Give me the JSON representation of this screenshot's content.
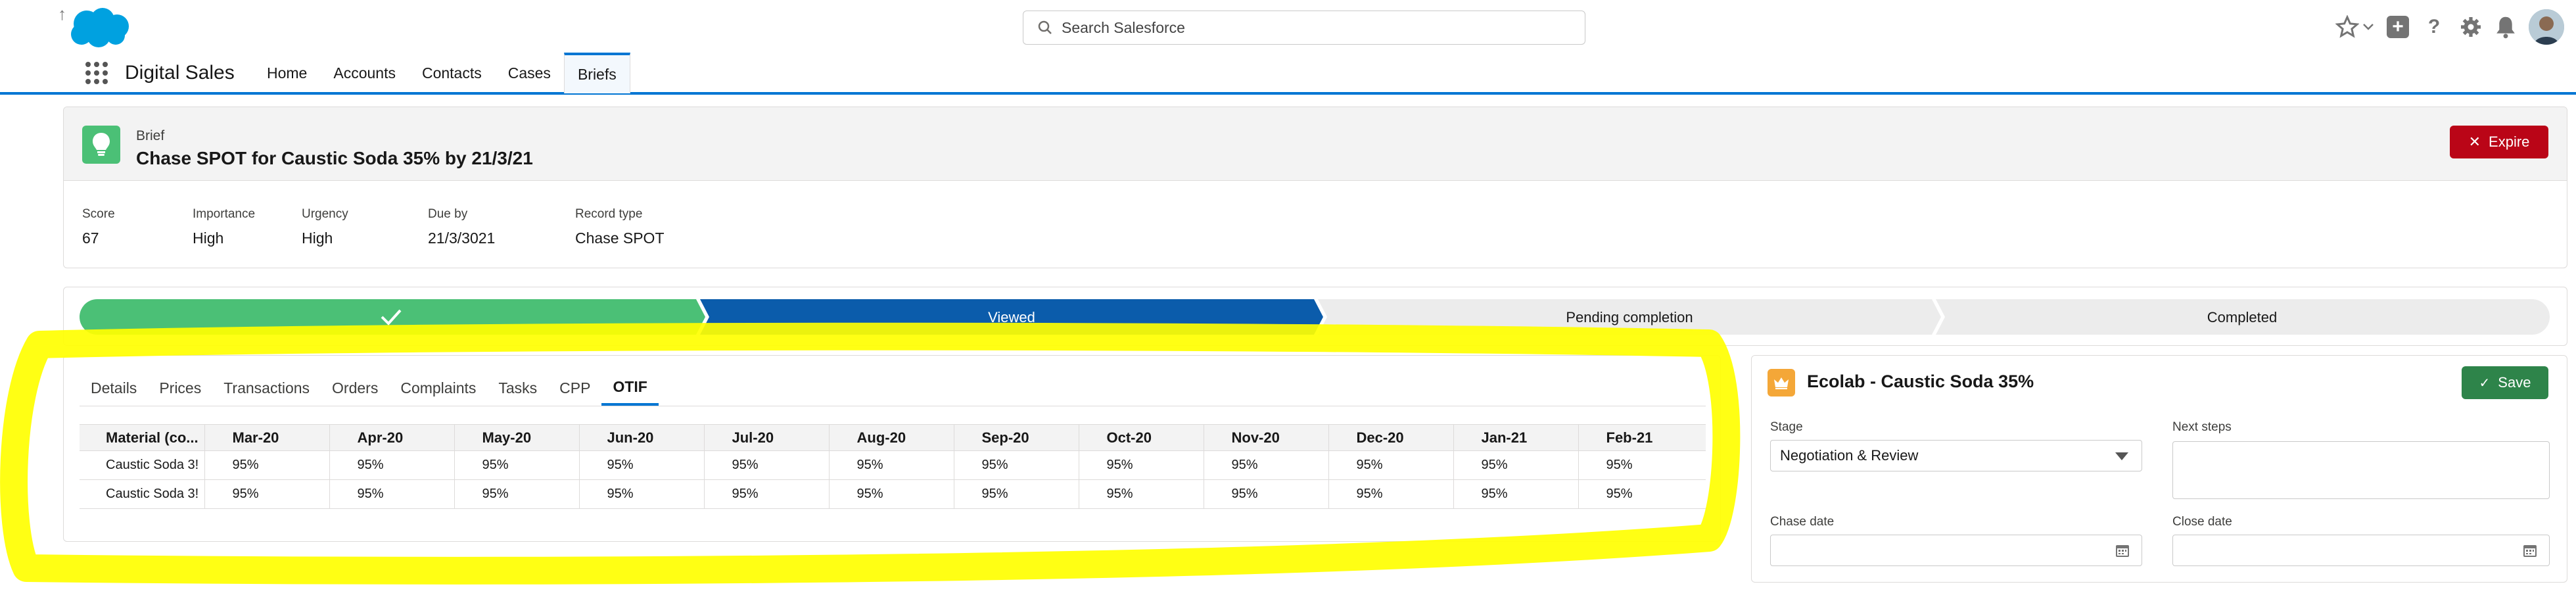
{
  "header": {
    "search_placeholder": "Search Salesforce",
    "icons": [
      "star-icon",
      "chevron-down-icon",
      "add-icon",
      "help-icon",
      "setup-gear-icon",
      "notification-bell-icon",
      "avatar"
    ]
  },
  "nav": {
    "app_name": "Digital Sales",
    "items": [
      {
        "label": "Home"
      },
      {
        "label": "Accounts"
      },
      {
        "label": "Contacts"
      },
      {
        "label": "Cases"
      },
      {
        "label": "Briefs",
        "active": true
      }
    ]
  },
  "record": {
    "object_label": "Brief",
    "title": "Chase SPOT for Caustic Soda 35% by 21/3/21",
    "expire_label": "Expire",
    "fields": [
      {
        "label": "Score",
        "value": "67"
      },
      {
        "label": "Importance",
        "value": "High"
      },
      {
        "label": "Urgency",
        "value": "High"
      },
      {
        "label": "Due by",
        "value": "21/3/3021"
      },
      {
        "label": "Record type",
        "value": "Chase SPOT"
      }
    ]
  },
  "path": {
    "stages": [
      {
        "label": "",
        "state": "complete"
      },
      {
        "label": "Viewed",
        "state": "current"
      },
      {
        "label": "Pending completion",
        "state": "incomplete"
      },
      {
        "label": "Completed",
        "state": "incomplete"
      }
    ]
  },
  "tabs": {
    "items": [
      "Details",
      "Prices",
      "Transactions",
      "Orders",
      "Complaints",
      "Tasks",
      "CPP",
      "OTIF"
    ],
    "active": "OTIF"
  },
  "otif_table": {
    "columns": [
      "Material (co...",
      "Mar-20",
      "Apr-20",
      "May-20",
      "Jun-20",
      "Jul-20",
      "Aug-20",
      "Sep-20",
      "Oct-20",
      "Nov-20",
      "Dec-20",
      "Jan-21",
      "Feb-21"
    ],
    "rows": [
      [
        "Caustic Soda 3!",
        "95%",
        "95%",
        "95%",
        "95%",
        "95%",
        "95%",
        "95%",
        "95%",
        "95%",
        "95%",
        "95%",
        "95%"
      ],
      [
        "Caustic Soda 3!",
        "95%",
        "95%",
        "95%",
        "95%",
        "95%",
        "95%",
        "95%",
        "95%",
        "95%",
        "95%",
        "95%",
        "95%"
      ]
    ]
  },
  "opportunity": {
    "title": "Ecolab - Caustic Soda 35%",
    "save_label": "Save",
    "stage_label": "Stage",
    "stage_value": "Negotiation & Review",
    "next_steps_label": "Next steps",
    "chase_date_label": "Chase date",
    "close_date_label": "Close date"
  },
  "colors": {
    "brand_blue": "#0176d3",
    "path_complete": "#4bc076",
    "path_current": "#0b5cab",
    "path_incomplete": "#ececec",
    "expire_red": "#ba0517",
    "save_green": "#2e844a",
    "highlight_yellow": "#ffff00"
  }
}
